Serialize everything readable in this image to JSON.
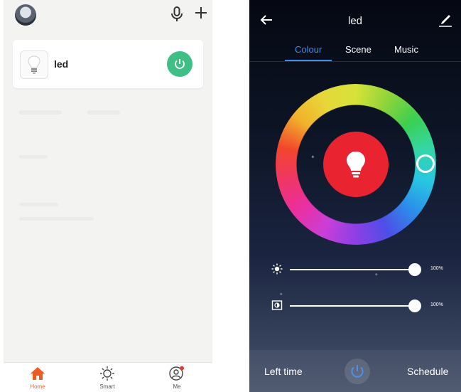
{
  "home": {
    "device": {
      "name": "led",
      "power_on": true
    },
    "tabs": [
      {
        "label": "Home",
        "icon": "home-icon",
        "active": true
      },
      {
        "label": "Smart",
        "icon": "sun-icon",
        "active": false
      },
      {
        "label": "Me",
        "icon": "profile-icon",
        "active": false
      }
    ],
    "colors": {
      "accent": "#ef5b25",
      "power": "#3fbf85",
      "background": "#f3f3f2"
    }
  },
  "control": {
    "title": "led",
    "tabs": [
      {
        "label": "Colour",
        "active": true
      },
      {
        "label": "Scene",
        "active": false
      },
      {
        "label": "Music",
        "active": false
      }
    ],
    "current_color": "#ea2330",
    "brightness": {
      "value": 1.0,
      "label": "100%"
    },
    "saturation": {
      "value": 1.0,
      "label": "100%"
    },
    "bottom": {
      "left_label": "Left time",
      "right_label": "Schedule"
    },
    "colors": {
      "tab_active": "#3f8cf0"
    }
  }
}
